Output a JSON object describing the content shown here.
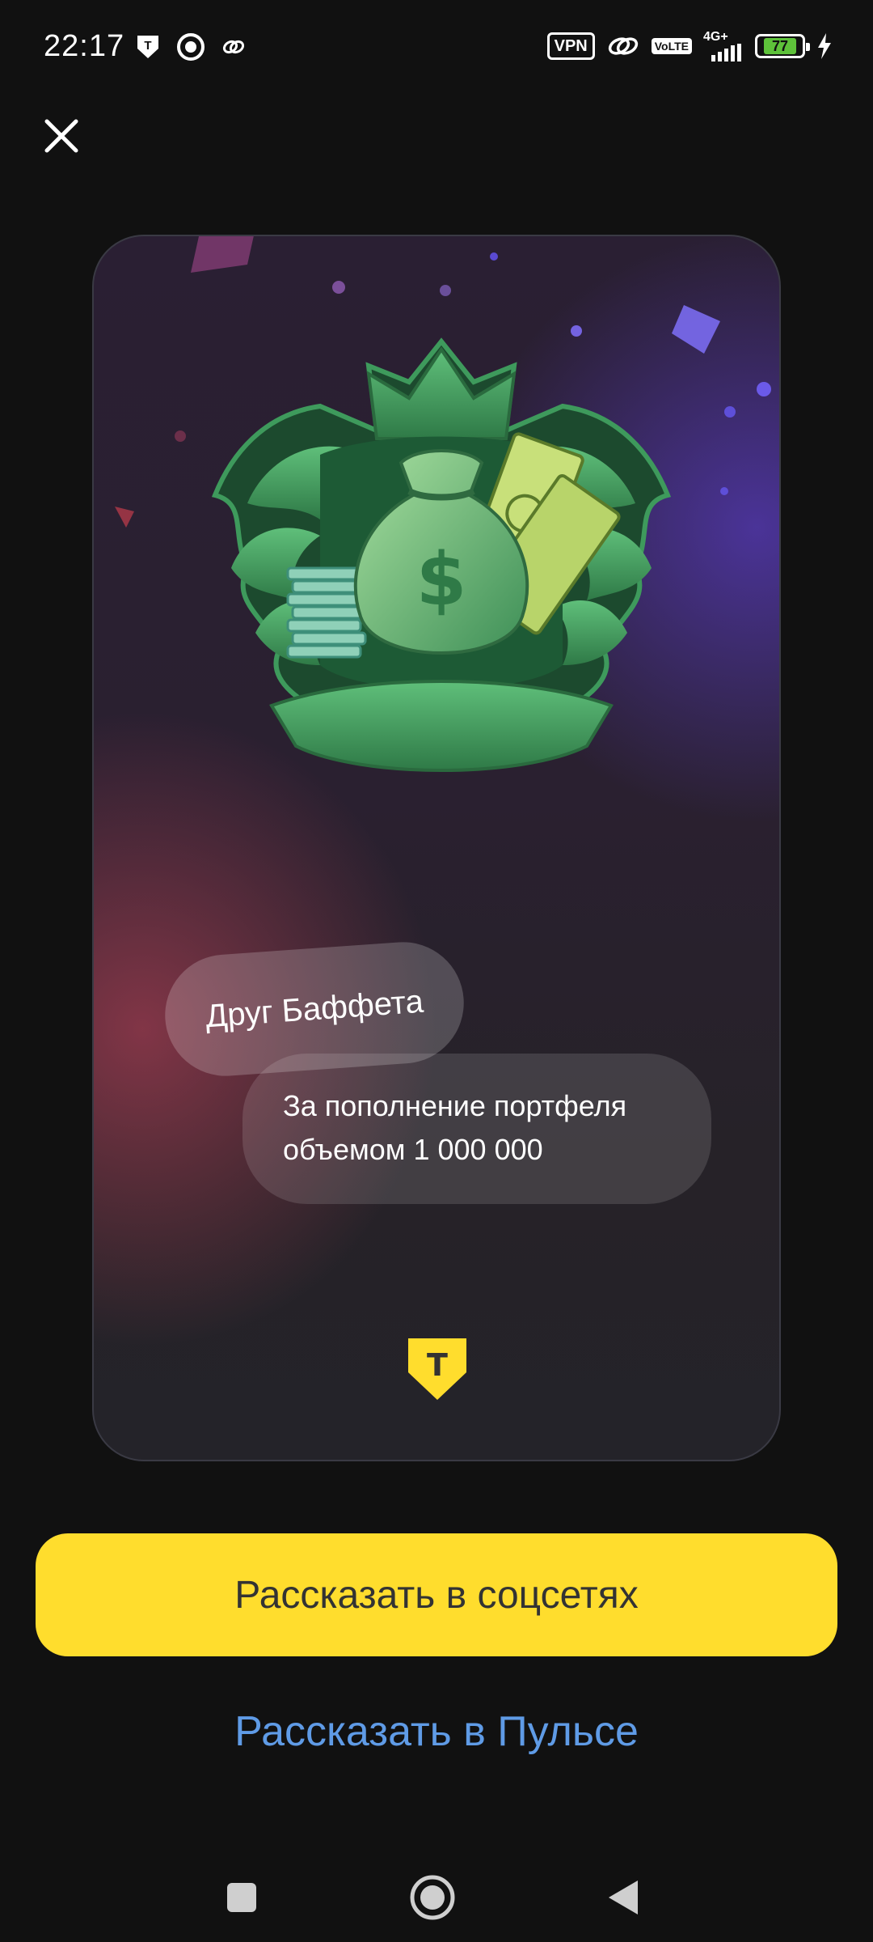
{
  "status_bar": {
    "time": "22:17",
    "vpn_label": "VPN",
    "volte_label_top": "Vo",
    "volte_label_bottom": "LTE",
    "network_label": "4G+",
    "battery_level": "77"
  },
  "close_icon": "close-icon",
  "achievement": {
    "title": "Друг Баффета",
    "description_line1": "За пополнение портфеля",
    "description_line2": "объемом 1 000 000",
    "emblem_icon": "money-bag-emblem-icon",
    "bank_logo": "T"
  },
  "actions": {
    "share_social_label": "Рассказать в соцсетях",
    "share_pulse_label": "Рассказать в Пульсе"
  },
  "colors": {
    "accent_yellow": "#ffdd2d",
    "link_blue": "#5f9be6",
    "background": "#111111",
    "emblem_green": "#3f9a5c"
  },
  "nav_bar": {
    "recents_icon": "square-icon",
    "home_icon": "circle-home-icon",
    "back_icon": "triangle-back-icon"
  }
}
